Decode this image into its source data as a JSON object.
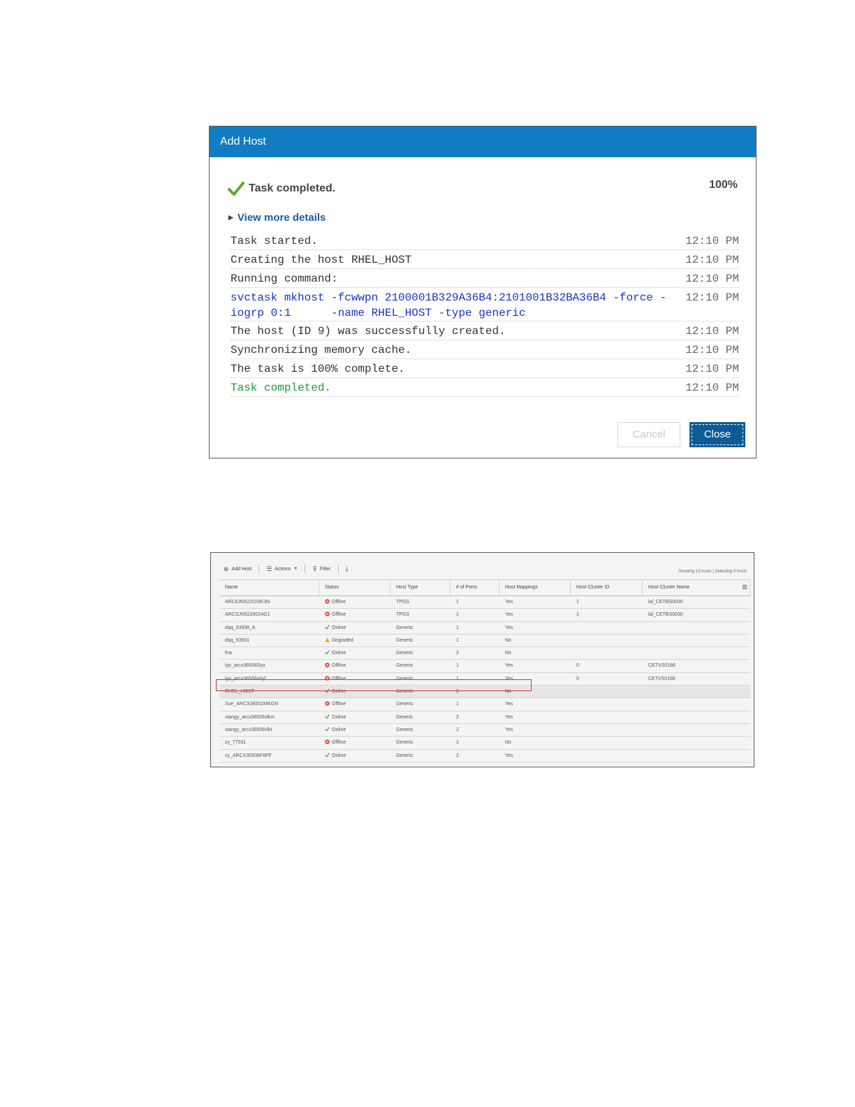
{
  "dialog": {
    "title": "Add Host",
    "status": "Task completed.",
    "progress": "100%",
    "details_link": "View more details",
    "log": [
      {
        "msg": "Task started.",
        "time": "12:10 PM",
        "kind": "normal"
      },
      {
        "msg": "Creating the host RHEL_HOST",
        "time": "12:10 PM",
        "kind": "normal"
      },
      {
        "msg": "Running command:",
        "time": "12:10 PM",
        "kind": "normal"
      },
      {
        "msg": "svctask mkhost -fcwwpn 2100001B329A36B4:2101001B32BA36B4 -force -iogrp 0:1      -name RHEL_HOST -type generic",
        "time": "12:10 PM",
        "kind": "cmd"
      },
      {
        "msg": "The host (ID 9) was successfully created.",
        "time": "12:10 PM",
        "kind": "normal"
      },
      {
        "msg": "Synchronizing memory cache.",
        "time": "12:10 PM",
        "kind": "normal"
      },
      {
        "msg": "The task is 100% complete.",
        "time": "12:10 PM",
        "kind": "normal"
      },
      {
        "msg": "Task completed.",
        "time": "12:10 PM",
        "kind": "done"
      }
    ],
    "cancel_label": "Cancel",
    "close_label": "Close"
  },
  "hosts_panel": {
    "toolbar": {
      "add_host": "Add Host",
      "actions": "Actions",
      "filter": "Filter"
    },
    "showing_text": "Showing 13 hosts | Selecting 0 hosts",
    "columns": [
      "Name",
      "Status",
      "Host Type",
      "# of Ports",
      "Host Mappings",
      "Host Cluster ID",
      "Host Cluster Name"
    ],
    "rows": [
      {
        "name": "ARC8JN522029K3N",
        "status": "Offline",
        "type": "TPGS",
        "ports": "1",
        "mappings": "Yes",
        "cluster_id": "1",
        "cluster_name": "lal_CETBS0030"
      },
      {
        "name": "ARCSJN5229024G1",
        "status": "Offline",
        "type": "TPGS",
        "ports": "1",
        "mappings": "Yes",
        "cluster_id": "1",
        "cluster_name": "lal_CETBS0030"
      },
      {
        "name": "dqq_53936_A",
        "status": "Online",
        "type": "Generic",
        "ports": "1",
        "mappings": "Yes",
        "cluster_id": "",
        "cluster_name": ""
      },
      {
        "name": "dqq_53931",
        "status": "Degraded",
        "type": "Generic",
        "ports": "1",
        "mappings": "No",
        "cluster_id": "",
        "cluster_name": ""
      },
      {
        "name": "fna",
        "status": "Online",
        "type": "Generic",
        "ports": "2",
        "mappings": "No",
        "cluster_id": "",
        "cluster_name": ""
      },
      {
        "name": "lyp_arcx36506l3yx",
        "status": "Offline",
        "type": "Generic",
        "ports": "1",
        "mappings": "Yes",
        "cluster_id": "0",
        "cluster_name": "CETVS0166"
      },
      {
        "name": "lyp_arcx36506v6yf",
        "status": "Offline",
        "type": "Generic",
        "ports": "1",
        "mappings": "Yes",
        "cluster_id": "0",
        "cluster_name": "CETVS0166"
      },
      {
        "name": "RHEL_HOST",
        "status": "Online",
        "type": "Generic",
        "ports": "2",
        "mappings": "No",
        "cluster_id": "",
        "cluster_name": ""
      },
      {
        "name": "Sue_ARCX36502MKGN",
        "status": "Offline",
        "type": "Generic",
        "ports": "1",
        "mappings": "Yes",
        "cluster_id": "",
        "cluster_name": ""
      },
      {
        "name": "xiangy_arcx36506vlkm",
        "status": "Online",
        "type": "Generic",
        "ports": "2",
        "mappings": "Yes",
        "cluster_id": "",
        "cluster_name": ""
      },
      {
        "name": "xiangy_arcx36506vlkt",
        "status": "Online",
        "type": "Generic",
        "ports": "2",
        "mappings": "Yes",
        "cluster_id": "",
        "cluster_name": ""
      },
      {
        "name": "zy_77031",
        "status": "Offline",
        "type": "Generic",
        "ports": "1",
        "mappings": "No",
        "cluster_id": "",
        "cluster_name": ""
      },
      {
        "name": "zy_ARCX36506F8PF",
        "status": "Online",
        "type": "Generic",
        "ports": "2",
        "mappings": "Yes",
        "cluster_id": "",
        "cluster_name": ""
      }
    ],
    "highlighted_row": "RHEL_HOST",
    "status_colors": {
      "Online": "#3a9a3a",
      "Offline": "#d9302a",
      "Degraded": "#e8a317"
    },
    "icons": {
      "add_host": "plus-circle-icon",
      "actions": "menu-list-icon",
      "filter": "filter-icon",
      "export": "download-icon",
      "columns": "columns-icon"
    }
  }
}
